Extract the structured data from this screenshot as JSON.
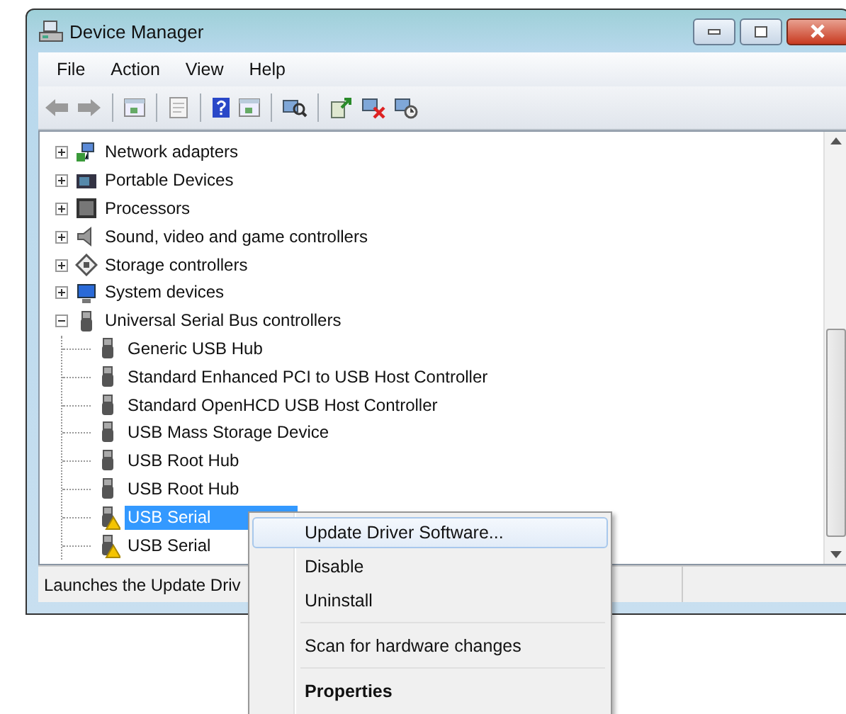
{
  "window": {
    "title": "Device Manager"
  },
  "menu": [
    {
      "label": "File"
    },
    {
      "label": "Action"
    },
    {
      "label": "View"
    },
    {
      "label": "Help"
    }
  ],
  "toolbar": [
    {
      "kind": "back"
    },
    {
      "kind": "forward"
    },
    {
      "kind": "separator"
    },
    {
      "kind": "console"
    },
    {
      "kind": "separator"
    },
    {
      "kind": "sheet"
    },
    {
      "kind": "separator"
    },
    {
      "kind": "help"
    },
    {
      "kind": "console"
    },
    {
      "kind": "separator"
    },
    {
      "kind": "scan"
    },
    {
      "kind": "separator"
    },
    {
      "kind": "update"
    },
    {
      "kind": "uninstall"
    },
    {
      "kind": "disable"
    }
  ],
  "tree": [
    {
      "label": "Network adapters",
      "kind": "network",
      "expanded": false,
      "selected": false
    },
    {
      "label": "Portable Devices",
      "kind": "portable",
      "expanded": false,
      "selected": false
    },
    {
      "label": "Processors",
      "kind": "processor",
      "expanded": false,
      "selected": false
    },
    {
      "label": "Sound, video and game controllers",
      "kind": "sound",
      "expanded": false,
      "selected": false
    },
    {
      "label": "Storage controllers",
      "kind": "storage",
      "expanded": false,
      "selected": false
    },
    {
      "label": "System devices",
      "kind": "system",
      "expanded": false,
      "selected": false
    },
    {
      "label": "Universal Serial Bus controllers",
      "kind": "usb",
      "expanded": true,
      "selected": false,
      "children": [
        {
          "label": "Generic USB Hub",
          "kind": "usb",
          "warning": false,
          "selected": false
        },
        {
          "label": "Standard Enhanced PCI to USB Host Controller",
          "kind": "usb",
          "warning": false,
          "selected": false
        },
        {
          "label": "Standard OpenHCD USB Host Controller",
          "kind": "usb",
          "warning": false,
          "selected": false
        },
        {
          "label": "USB Mass Storage Device",
          "kind": "usb",
          "warning": false,
          "selected": false
        },
        {
          "label": "USB Root Hub",
          "kind": "usb",
          "warning": false,
          "selected": false
        },
        {
          "label": "USB Root Hub",
          "kind": "usb",
          "warning": false,
          "selected": false
        },
        {
          "label": "USB Serial",
          "kind": "usb",
          "warning": true,
          "selected": true
        },
        {
          "label": "USB Serial",
          "kind": "usb",
          "warning": true,
          "selected": false
        }
      ]
    }
  ],
  "status_bar": {
    "text": "Launches the Update Driv"
  },
  "context_menu": [
    {
      "kind": "item",
      "label": "Update Driver Software...",
      "selected": true,
      "default": false
    },
    {
      "kind": "item",
      "label": "Disable",
      "selected": false,
      "default": false
    },
    {
      "kind": "item",
      "label": "Uninstall",
      "selected": false,
      "default": false
    },
    {
      "kind": "separator"
    },
    {
      "kind": "item",
      "label": "Scan for hardware changes",
      "selected": false,
      "default": false
    },
    {
      "kind": "separator"
    },
    {
      "kind": "item",
      "label": "Properties",
      "selected": false,
      "default": true
    }
  ]
}
